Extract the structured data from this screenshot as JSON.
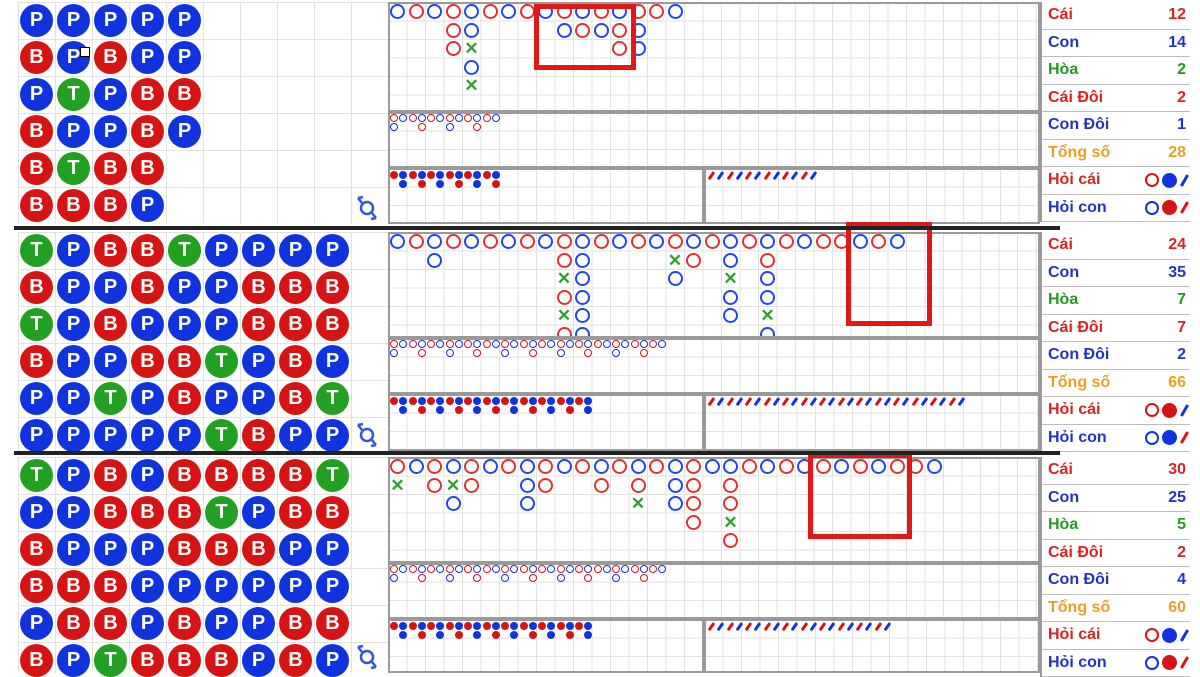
{
  "colors": {
    "banker": "#d61414",
    "player": "#1133dd",
    "tie": "#22a022",
    "highlight": "#e01818",
    "total": "#e8a020"
  },
  "panels": [
    {
      "bead_road": [
        [
          "P",
          "P",
          "P",
          "P",
          "P"
        ],
        [
          "B",
          "P",
          "B",
          "P",
          "P"
        ],
        [
          "P",
          "T",
          "P",
          "B",
          "B"
        ],
        [
          "B",
          "P",
          "P",
          "B",
          "P"
        ],
        [
          "B",
          "T",
          "B",
          "B"
        ],
        [
          "B",
          "B",
          "B",
          "P"
        ]
      ],
      "stats": [
        {
          "label": "Cái",
          "value": "12",
          "tone": "red"
        },
        {
          "label": "Con",
          "value": "14",
          "tone": "blue"
        },
        {
          "label": "Hòa",
          "value": "2",
          "tone": "green"
        },
        {
          "label": "Cái Đôi",
          "value": "2",
          "tone": "red"
        },
        {
          "label": "Con Đôi",
          "value": "1",
          "tone": "blue"
        },
        {
          "label": "Tổng số",
          "value": "28",
          "tone": "orange"
        }
      ],
      "ask_banker": {
        "label": "Hỏi cái",
        "ring": "B",
        "dot": "P",
        "slash": "P"
      },
      "ask_player": {
        "label": "Hỏi con",
        "ring": "P",
        "dot": "B",
        "slash": "B"
      }
    },
    {
      "bead_road": [
        [
          "T",
          "P",
          "B",
          "B",
          "T",
          "P",
          "P",
          "P",
          "P"
        ],
        [
          "B",
          "P",
          "P",
          "B",
          "P",
          "P",
          "B",
          "B",
          "B"
        ],
        [
          "T",
          "P",
          "B",
          "P",
          "P",
          "P",
          "B",
          "B",
          "B"
        ],
        [
          "B",
          "P",
          "P",
          "B",
          "B",
          "T",
          "P",
          "B",
          "P"
        ],
        [
          "P",
          "P",
          "T",
          "P",
          "B",
          "P",
          "P",
          "B",
          "T"
        ],
        [
          "P",
          "P",
          "P",
          "P",
          "P",
          "T",
          "B",
          "P",
          "P"
        ]
      ],
      "stats": [
        {
          "label": "Cái",
          "value": "24",
          "tone": "red"
        },
        {
          "label": "Con",
          "value": "35",
          "tone": "blue"
        },
        {
          "label": "Hòa",
          "value": "7",
          "tone": "green"
        },
        {
          "label": "Cái Đôi",
          "value": "7",
          "tone": "red"
        },
        {
          "label": "Con Đôi",
          "value": "2",
          "tone": "blue"
        },
        {
          "label": "Tổng số",
          "value": "66",
          "tone": "orange"
        }
      ],
      "ask_banker": {
        "label": "Hỏi cái",
        "ring": "B",
        "dot": "B",
        "slash": "P"
      },
      "ask_player": {
        "label": "Hỏi con",
        "ring": "P",
        "dot": "P",
        "slash": "B"
      }
    },
    {
      "bead_road": [
        [
          "T",
          "P",
          "B",
          "P",
          "B",
          "B",
          "B",
          "B",
          "T"
        ],
        [
          "P",
          "P",
          "B",
          "B",
          "B",
          "T",
          "P",
          "B",
          "B"
        ],
        [
          "B",
          "P",
          "P",
          "P",
          "B",
          "B",
          "B",
          "P",
          "P"
        ],
        [
          "B",
          "B",
          "B",
          "P",
          "P",
          "P",
          "P",
          "P",
          "P"
        ],
        [
          "P",
          "B",
          "B",
          "P",
          "B",
          "P",
          "P",
          "B",
          "B"
        ],
        [
          "B",
          "P",
          "T",
          "B",
          "B",
          "B",
          "P",
          "B",
          "P"
        ]
      ],
      "stats": [
        {
          "label": "Cái",
          "value": "30",
          "tone": "red"
        },
        {
          "label": "Con",
          "value": "25",
          "tone": "blue"
        },
        {
          "label": "Hòa",
          "value": "5",
          "tone": "green"
        },
        {
          "label": "Cái Đôi",
          "value": "2",
          "tone": "red"
        },
        {
          "label": "Con Đôi",
          "value": "4",
          "tone": "blue"
        },
        {
          "label": "Tổng số",
          "value": "60",
          "tone": "orange"
        }
      ],
      "ask_banker": {
        "label": "Hỏi cái",
        "ring": "B",
        "dot": "P",
        "slash": "P"
      },
      "ask_player": {
        "label": "Hỏi con",
        "ring": "P",
        "dot": "B",
        "slash": "B"
      }
    }
  ],
  "icons": {
    "swap": "swap-icon",
    "cursor": "cursor-icon"
  }
}
